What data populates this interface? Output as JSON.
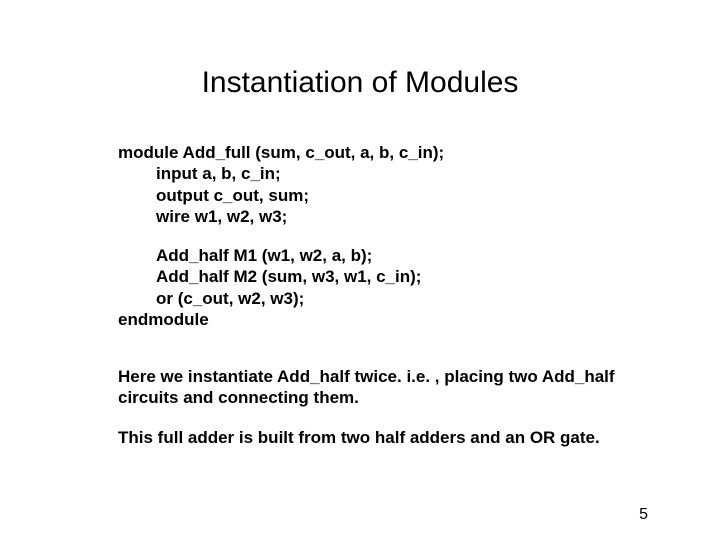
{
  "title": "Instantiation of Modules",
  "code": {
    "l1": "module Add_full (sum, c_out, a, b, c_in);",
    "l2": "input a, b, c_in;",
    "l3": "output c_out, sum;",
    "l4": "wire w1, w2, w3;",
    "l5": "Add_half M1 (w1, w2, a, b);",
    "l6": "Add_half M2 (sum, w3, w1, c_in);",
    "l7": "or (c_out, w2, w3);",
    "l8": "endmodule"
  },
  "note1": "Here we instantiate Add_half twice. i.e. , placing two Add_half circuits and connecting them.",
  "note2": "This full adder is built from two half adders and an OR gate.",
  "page": "5"
}
